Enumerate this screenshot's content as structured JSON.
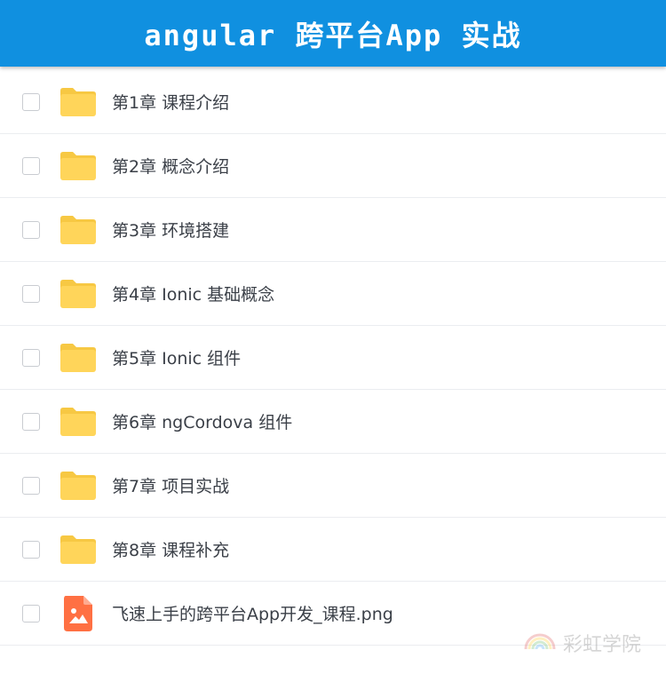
{
  "header": {
    "title": "angular 跨平台App 实战",
    "background": "#1090e0"
  },
  "items": [
    {
      "label": "第1章 课程介绍",
      "icon": "folder-icon"
    },
    {
      "label": "第2章 概念介绍",
      "icon": "folder-icon"
    },
    {
      "label": "第3章 环境搭建",
      "icon": "folder-icon"
    },
    {
      "label": "第4章 Ionic 基础概念",
      "icon": "folder-icon"
    },
    {
      "label": "第5章 Ionic 组件",
      "icon": "folder-icon"
    },
    {
      "label": "第6章 ngCordova 组件",
      "icon": "folder-icon"
    },
    {
      "label": "第7章 项目实战",
      "icon": "folder-icon"
    },
    {
      "label": "第8章 课程补充",
      "icon": "folder-icon"
    },
    {
      "label": "飞速上手的跨平台App开发_课程.png",
      "icon": "image-file-icon"
    }
  ],
  "colors": {
    "folder": "#ffd55a",
    "folder_tab": "#f7c843",
    "image_file": "#ff7043"
  },
  "watermark": {
    "text": "彩虹学院"
  }
}
